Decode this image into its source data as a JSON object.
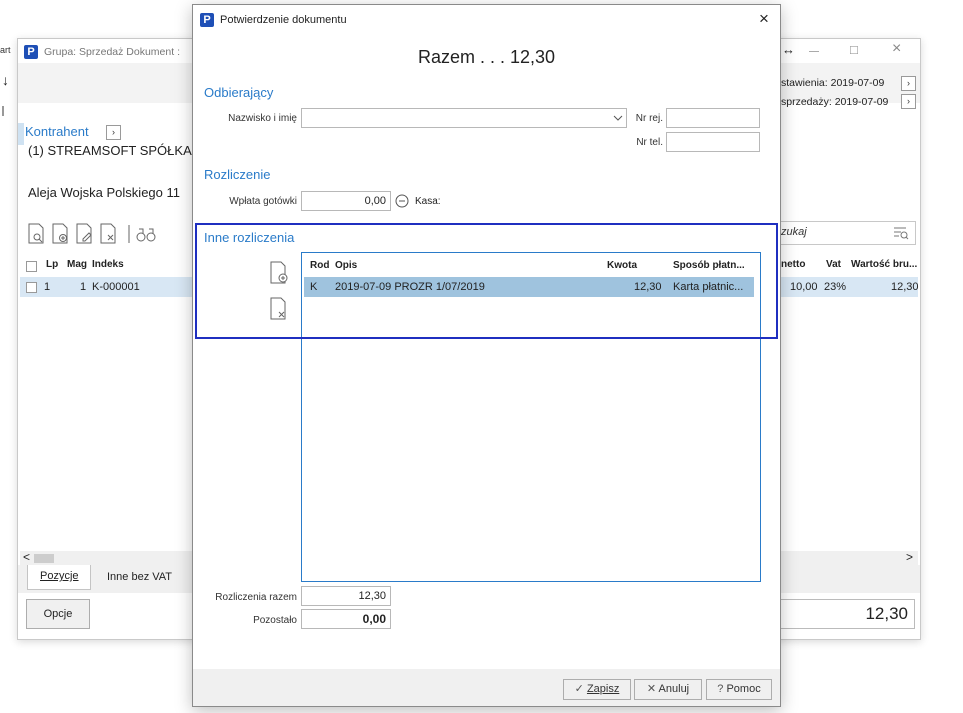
{
  "background_window": {
    "left_edge_text": "art",
    "title": "Grupa: Sprzedaż   Dokument :",
    "arrow_glyph": "↓",
    "kontrahent_label": "Kontrahent",
    "kontrahent_name": "(1) STREAMSOFT SPÓŁKA",
    "kontrahent_address": "Aleja Wojska Polskiego 11",
    "date_issue": "stawienia: 2019-07-09",
    "date_sale": "sprzedaży: 2019-07-09",
    "search_placeholder": "zukaj",
    "columns_left": [
      "Lp",
      "Mag",
      "Indeks"
    ],
    "row_left": {
      "lp": "1",
      "mag": "1",
      "indeks": "K-000001"
    },
    "columns_right": [
      "netto",
      "Vat",
      "Wartość bru..."
    ],
    "row_right": {
      "netto": "10,00",
      "vat": "23%",
      "brutto": "12,30"
    },
    "tabs": [
      "Pozycje",
      "Inne bez VAT"
    ],
    "options_button": "Opcje",
    "total": "12,30",
    "restore_glyph": "↔",
    "maximize_glyph": "□",
    "close_glyph": "×",
    "scroll_left": "<",
    "scroll_right": ">"
  },
  "dialog": {
    "title": "Potwierdzenie dokumentu",
    "close_glyph": "×",
    "total_line": "Razem . . . 12,30",
    "odbierajacy": {
      "section": "Odbierający",
      "name_label": "Nazwisko i imię",
      "name_value": "",
      "reg_label": "Nr rej.",
      "tel_label": "Nr tel."
    },
    "rozliczenie": {
      "section": "Rozliczenie",
      "cash_label": "Wpłata gotówki",
      "cash_value": "0,00",
      "kasa_label": "Kasa:"
    },
    "inne": {
      "section": "Inne rozliczenia",
      "columns": {
        "rod": "Rod",
        "opis": "Opis",
        "kwota": "Kwota",
        "sposob": "Sposób płatn..."
      },
      "rows": [
        {
          "rod": "K",
          "opis": "2019-07-09 PROZR 1/07/2019",
          "kwota": "12,30",
          "sposob": "Karta płatnic..."
        }
      ]
    },
    "summary": {
      "total_label": "Rozliczenia razem",
      "total_value": "12,30",
      "rest_label": "Pozostało",
      "rest_value": "0,00"
    },
    "buttons": {
      "save": "Zapisz",
      "cancel": "Anuluj",
      "help": "Pomoc"
    }
  }
}
